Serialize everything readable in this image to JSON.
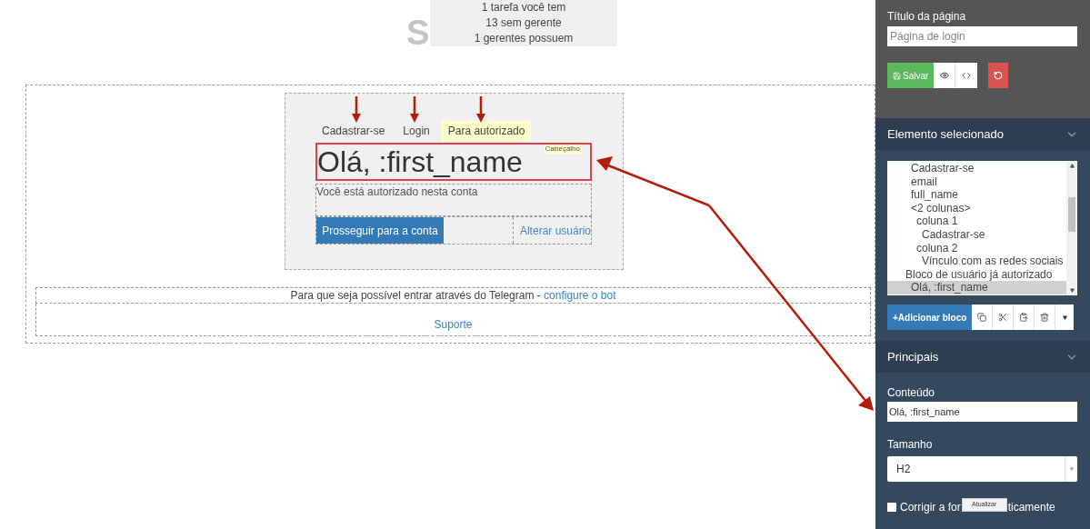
{
  "page_heading": "S",
  "stats_tooltip": [
    "1 tarefa você tem",
    "13 sem gerente",
    "1 gerentes possuem"
  ],
  "preview": {
    "tabs": [
      {
        "label": "Cadastrar-se",
        "selected": false
      },
      {
        "label": "Login",
        "selected": false
      },
      {
        "label": "Para autorizado",
        "selected": true
      }
    ],
    "heading": {
      "text": "Olá, :first_name",
      "tag": "Cabeçalho",
      "selected": true
    },
    "message": "Você está autorizado nesta conta",
    "primary_button": "Prosseguir para a conta",
    "secondary_link": "Alterar usuário",
    "telegram_note": {
      "text": "Para que seja possível entrar através do Telegram - ",
      "link": "configure o bot"
    },
    "support_link": "Suporte"
  },
  "sidebar": {
    "page_title": {
      "label": "Título da página",
      "placeholder": "Página de login"
    },
    "toolbar": {
      "save": "Salvar"
    },
    "selected_section": {
      "title": "Elemento selecionado",
      "tree": {
        "scrolled_children": [
          {
            "label": "Cadastrar-se",
            "selected": false
          },
          {
            "label": "email",
            "selected": false
          },
          {
            "label": "full_name",
            "selected": false
          },
          {
            "label": "<2 colunas>",
            "selected": false,
            "children": [
              {
                "label": "coluna 1",
                "selected": false,
                "children": [
                  {
                    "label": "Cadastrar-se",
                    "selected": false
                  }
                ]
              },
              {
                "label": "coluna 2",
                "selected": false,
                "children": [
                  {
                    "label": "Vínculo com as redes sociais",
                    "selected": false
                  }
                ]
              }
            ]
          }
        ],
        "items": [
          {
            "label": "Bloco de usuário já autorizado",
            "selected": false,
            "children": [
              {
                "label": "Olá, :first_name",
                "selected": true
              }
            ]
          }
        ]
      },
      "add_block": "+Adicionar bloco"
    },
    "main_section": {
      "title": "Principais",
      "content": {
        "label": "Conteúdo",
        "value": "Olá, :first_name"
      },
      "size": {
        "label": "Tamanho",
        "value": "H2"
      },
      "auto_fix": {
        "checked": false,
        "label_before": "Corrigir a for",
        "label_after": "ticamente"
      },
      "update_button": "Atualizar"
    }
  }
}
